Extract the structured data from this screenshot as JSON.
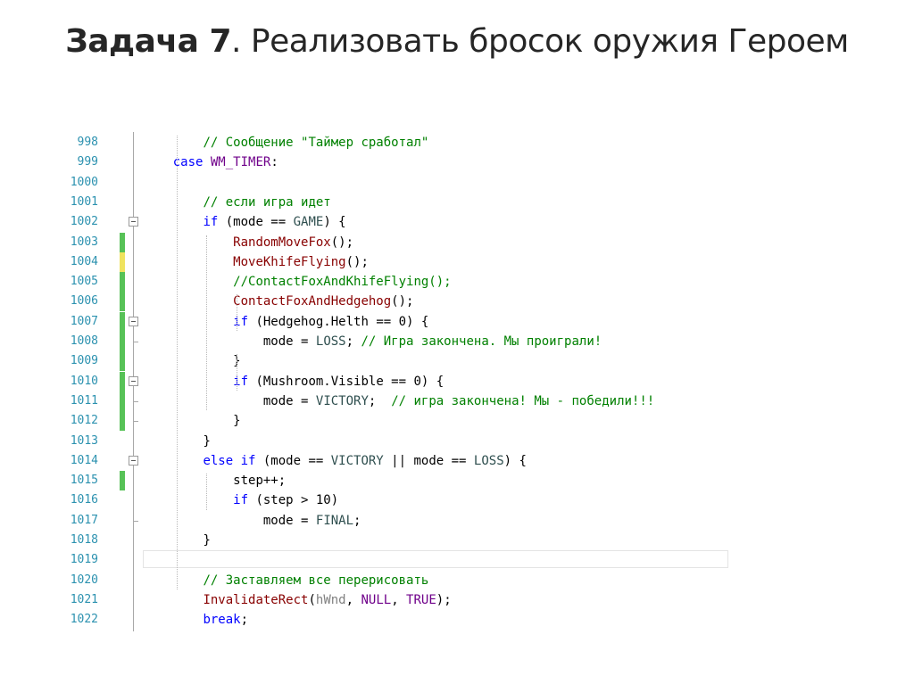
{
  "slide": {
    "title_bold": "Задача 7",
    "title_rest": ". Реализовать бросок оружия Героем"
  },
  "editor": {
    "colors": {
      "line_number": "#2b91af",
      "keyword": "#0000ff",
      "comment": "#008000",
      "function": "#880000",
      "macro": "#6f008a",
      "change_saved": "#57c257",
      "change_unsaved": "#efe35f"
    },
    "lines": [
      {
        "n": "998",
        "indent": 2,
        "change": "",
        "fold": false,
        "tokens": [
          {
            "t": "// Сообщение ",
            "c": "cm"
          },
          {
            "t": "\"Таймер сработал\"",
            "c": "cm"
          }
        ]
      },
      {
        "n": "999",
        "indent": 1,
        "change": "",
        "fold": false,
        "tokens": [
          {
            "t": "case ",
            "c": "kw"
          },
          {
            "t": "WM_TIMER",
            "c": "mc"
          },
          {
            "t": ":",
            "c": ""
          }
        ]
      },
      {
        "n": "1000",
        "indent": 0,
        "change": "",
        "fold": false,
        "tokens": []
      },
      {
        "n": "1001",
        "indent": 2,
        "change": "",
        "fold": false,
        "tokens": [
          {
            "t": "// если игра идет",
            "c": "cm"
          }
        ]
      },
      {
        "n": "1002",
        "indent": 2,
        "change": "",
        "fold": true,
        "tokens": [
          {
            "t": "if ",
            "c": "kw"
          },
          {
            "t": "(mode == ",
            "c": ""
          },
          {
            "t": "GAME",
            "c": "en"
          },
          {
            "t": ") {",
            "c": ""
          }
        ]
      },
      {
        "n": "1003",
        "indent": 3,
        "change": "green",
        "fold": false,
        "tokens": [
          {
            "t": "RandomMoveFox",
            "c": "fn"
          },
          {
            "t": "();",
            "c": ""
          }
        ]
      },
      {
        "n": "1004",
        "indent": 3,
        "change": "yellow",
        "fold": false,
        "tokens": [
          {
            "t": "MoveKhifeFlying",
            "c": "fn"
          },
          {
            "t": "();",
            "c": ""
          }
        ]
      },
      {
        "n": "1005",
        "indent": 3,
        "change": "green",
        "fold": false,
        "tokens": [
          {
            "t": "//ContactFoxAndKhifeFlying();",
            "c": "cm"
          }
        ]
      },
      {
        "n": "1006",
        "indent": 3,
        "change": "green",
        "fold": false,
        "tokens": [
          {
            "t": "ContactFoxAndHedgehog",
            "c": "fn"
          },
          {
            "t": "();",
            "c": ""
          }
        ]
      },
      {
        "n": "1007",
        "indent": 3,
        "change": "green",
        "fold": true,
        "tokens": [
          {
            "t": "if ",
            "c": "kw"
          },
          {
            "t": "(Hedgehog.Helth == 0) {",
            "c": ""
          }
        ]
      },
      {
        "n": "1008",
        "indent": 4,
        "change": "green",
        "fold": false,
        "tokens": [
          {
            "t": "mode = ",
            "c": ""
          },
          {
            "t": "LOSS",
            "c": "en"
          },
          {
            "t": "; ",
            "c": ""
          },
          {
            "t": "// Игра закончена. Мы проиграли!",
            "c": "cm"
          }
        ]
      },
      {
        "n": "1009",
        "indent": 3,
        "change": "green",
        "fold": false,
        "tokens": [
          {
            "t": "}",
            "c": ""
          }
        ]
      },
      {
        "n": "1010",
        "indent": 3,
        "change": "green",
        "fold": true,
        "tokens": [
          {
            "t": "if ",
            "c": "kw"
          },
          {
            "t": "(Mushroom.Visible == 0) {",
            "c": ""
          }
        ]
      },
      {
        "n": "1011",
        "indent": 4,
        "change": "green",
        "fold": false,
        "tokens": [
          {
            "t": "mode = ",
            "c": ""
          },
          {
            "t": "VICTORY",
            "c": "en"
          },
          {
            "t": ";  ",
            "c": ""
          },
          {
            "t": "// игра закончена! Мы - победили!!!",
            "c": "cm"
          }
        ]
      },
      {
        "n": "1012",
        "indent": 3,
        "change": "green",
        "fold": false,
        "tokens": [
          {
            "t": "}",
            "c": ""
          }
        ]
      },
      {
        "n": "1013",
        "indent": 2,
        "change": "",
        "fold": false,
        "tokens": [
          {
            "t": "}",
            "c": ""
          }
        ]
      },
      {
        "n": "1014",
        "indent": 2,
        "change": "",
        "fold": true,
        "tokens": [
          {
            "t": "else if ",
            "c": "kw"
          },
          {
            "t": "(mode == ",
            "c": ""
          },
          {
            "t": "VICTORY",
            "c": "en"
          },
          {
            "t": " || mode == ",
            "c": ""
          },
          {
            "t": "LOSS",
            "c": "en"
          },
          {
            "t": ") {",
            "c": ""
          }
        ]
      },
      {
        "n": "1015",
        "indent": 3,
        "change": "green",
        "fold": false,
        "tokens": [
          {
            "t": "step++;",
            "c": ""
          }
        ]
      },
      {
        "n": "1016",
        "indent": 3,
        "change": "",
        "fold": false,
        "tokens": [
          {
            "t": "if ",
            "c": "kw"
          },
          {
            "t": "(step > 10)",
            "c": ""
          }
        ]
      },
      {
        "n": "1017",
        "indent": 4,
        "change": "",
        "fold": false,
        "tokens": [
          {
            "t": "mode = ",
            "c": ""
          },
          {
            "t": "FINAL",
            "c": "en"
          },
          {
            "t": ";",
            "c": ""
          }
        ]
      },
      {
        "n": "1018",
        "indent": 2,
        "change": "",
        "fold": false,
        "tokens": [
          {
            "t": "}",
            "c": ""
          }
        ]
      },
      {
        "n": "1019",
        "indent": 0,
        "change": "",
        "fold": false,
        "tokens": []
      },
      {
        "n": "1020",
        "indent": 2,
        "change": "",
        "fold": false,
        "tokens": [
          {
            "t": "// Заставляем все перерисовать",
            "c": "cm"
          }
        ]
      },
      {
        "n": "1021",
        "indent": 2,
        "change": "",
        "fold": false,
        "tokens": [
          {
            "t": "InvalidateRect",
            "c": "fn"
          },
          {
            "t": "(",
            "c": ""
          },
          {
            "t": "hWnd",
            "c": "pm"
          },
          {
            "t": ", ",
            "c": ""
          },
          {
            "t": "NULL",
            "c": "mc"
          },
          {
            "t": ", ",
            "c": ""
          },
          {
            "t": "TRUE",
            "c": "mc"
          },
          {
            "t": ");",
            "c": ""
          }
        ]
      },
      {
        "n": "1022",
        "indent": 2,
        "change": "",
        "fold": false,
        "tokens": [
          {
            "t": "break",
            "c": "kw"
          },
          {
            "t": ";",
            "c": ""
          }
        ]
      }
    ]
  }
}
